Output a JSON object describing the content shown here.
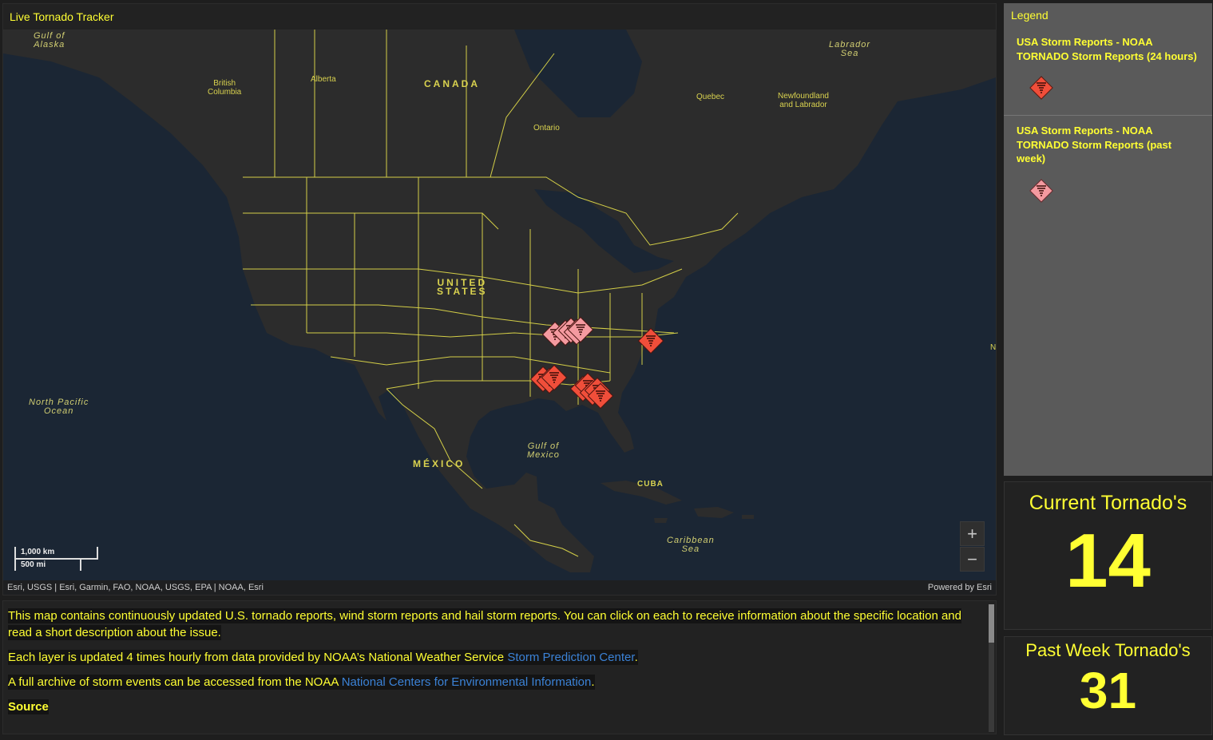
{
  "map": {
    "title": "Live Tornado Tracker",
    "labels": {
      "gulf_of_alaska": "Gulf of\nAlaska",
      "labrador_sea": "Labrador\nSea",
      "british_columbia": "British\nColumbia",
      "alberta": "Alberta",
      "canada": "CANADA",
      "quebec": "Quebec",
      "newfoundland": "Newfoundland\nand Labrador",
      "ontario": "Ontario",
      "united_states": "UNITED\nSTATES",
      "north_pacific": "North Pacific\nOcean",
      "gulf_of_mexico": "Gulf of\nMexico",
      "mexico": "MÉXICO",
      "cuba": "CUBA",
      "caribbean": "Caribbean\nSea",
      "edge_n": "N"
    },
    "scale_top": "1,000 km",
    "scale_bottom": "500 mi",
    "zoom_in": "+",
    "zoom_out": "−",
    "attribution": "Esri, USGS | Esri, Garmin, FAO, NOAA, USGS, EPA | NOAA, Esri",
    "powered_by": "Powered by Esri",
    "colors": {
      "current": "#f04e3a",
      "past_week": "#f49aa0",
      "border": "#e6e04a",
      "land": "#2c2c2c",
      "water": "#1b2634"
    }
  },
  "legend": {
    "title": "Legend",
    "items": [
      {
        "label": "USA Storm Reports - NOAA TORNADO Storm Reports (24 hours)",
        "color": "#f04e3a",
        "icon": "tornado-icon"
      },
      {
        "label": "USA Storm Reports - NOAA TORNADO Storm Reports (past week)",
        "color": "#f49aa0",
        "icon": "tornado-icon"
      }
    ]
  },
  "indicators": {
    "current": {
      "title": "Current Tornado's",
      "value": "14"
    },
    "week": {
      "title": "Past Week Tornado's",
      "value": "31"
    }
  },
  "description": {
    "p1": "This map contains continuously updated U.S. tornado reports, wind storm reports and hail storm reports. You can click on each to receive information about the specific location and read a short description about the issue.",
    "p2_text": "Each layer is updated 4 times hourly from data provided by NOAA’s National Weather Service ",
    "p2_link": "Storm Prediction Center",
    "p2_end": ".",
    "p3_text": "A full archive of storm events can be accessed from the NOAA ",
    "p3_link": "National Centers for Environmental Information",
    "p3_end": ".",
    "source": "Source"
  }
}
